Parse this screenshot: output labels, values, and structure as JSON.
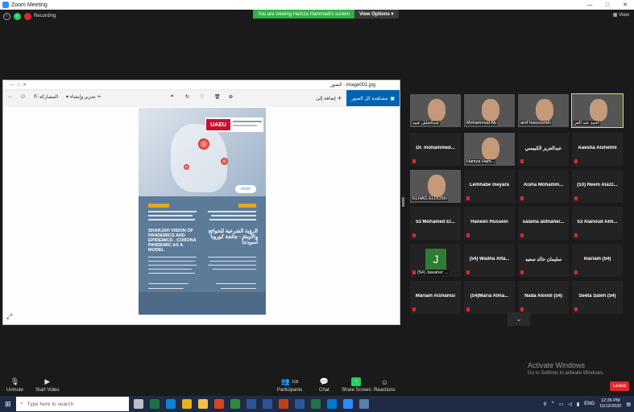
{
  "window": {
    "title": "Zoom Meeting",
    "controls": [
      "—",
      "□",
      "✕"
    ]
  },
  "topstrip": {
    "recording_label": "Recording",
    "viewing_msg": "You are viewing Hamza Hammadi's screen",
    "view_options": "View Options ▾",
    "view_button": "View"
  },
  "viewer": {
    "title": "الصور - image001.jpg",
    "toolbar": {
      "see_all": "مشاهدة كل الصور",
      "add_to": "إضافة إلى",
      "edit_create": "تحرير وإنشاء",
      "share": "المشاركة",
      "more": "..."
    }
  },
  "poster": {
    "logo_text": "UAEU",
    "zoom_logo": "zoom",
    "heading_en": "SHARJAH VISION OF PANDEMICS AND EPIDEMICS - CORONA PANDEMIC AS A MODEL",
    "heading_ar": "الرؤية الشرعية للحوائج والأوبئة - جائحة كورونا أنموذجاً"
  },
  "participants": [
    {
      "name": "عبدالجليل عبيد",
      "video": true
    },
    {
      "name": "Mohammad Ab",
      "video": true
    },
    {
      "name": "aref hassouneh",
      "video": true
    },
    {
      "name": "أحمد عبد العز",
      "video": true,
      "active": true
    },
    {
      "name": "Dr. mohammed...",
      "video": false
    },
    {
      "name": "Hamza Ham...",
      "video": true
    },
    {
      "name": "عبدالعزيز الكبيسي",
      "video": false
    },
    {
      "name": "Aaesha Alshehhi",
      "video": false
    },
    {
      "name": "ELHAG ELDOSH",
      "video": true
    },
    {
      "name": "Lemhabe meyara",
      "video": false
    },
    {
      "name": "Aisha Mohamm...",
      "video": false
    },
    {
      "name": "(53) Reem Alazz...",
      "video": false
    },
    {
      "name": "53 Mohamed El...",
      "video": false
    },
    {
      "name": "Haneen Hussein",
      "video": false
    },
    {
      "name": "salama aldhaher...",
      "video": false
    },
    {
      "name": "53 Alanoud Alm...",
      "video": false
    },
    {
      "name": "(54) Jawaher ...",
      "video": false,
      "avatar": "J"
    },
    {
      "name": "(54) Wadha Alfa...",
      "video": false
    },
    {
      "name": "سليمان خالد سعيد",
      "video": false
    },
    {
      "name": "mariam (54)",
      "video": false
    },
    {
      "name": "Mariam Alshamsi",
      "video": false
    },
    {
      "name": "(54)Maria Alma...",
      "video": false
    },
    {
      "name": "Nada Aloodi (54)",
      "video": false
    },
    {
      "name": "Seeta Saleh (54)",
      "video": false
    }
  ],
  "activate": {
    "line1": "Activate Windows",
    "line2": "Go to Settings to activate Windows."
  },
  "zoombar": {
    "unmute": "Unmute",
    "start_video": "Start Video",
    "participants": "Participants",
    "participants_count": "105",
    "chat": "Chat",
    "share_screen": "Share Screen",
    "reactions": "Reactions",
    "leave": "Leave"
  },
  "taskbar": {
    "search_placeholder": "Type here to search",
    "time": "12:26 PM",
    "date": "11/12/2020"
  }
}
